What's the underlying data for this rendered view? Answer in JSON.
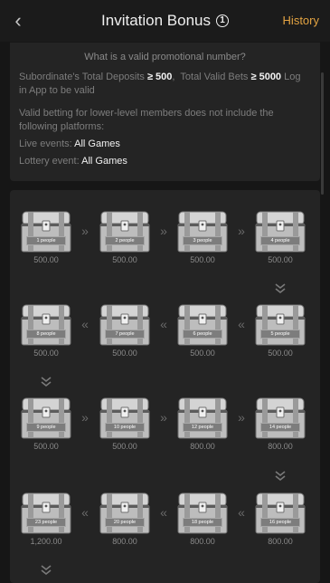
{
  "header": {
    "back_icon": "back-chevron-icon",
    "title": "Invitation Bonus",
    "info_icon": "info-circle-icon",
    "history_label": "History"
  },
  "info": {
    "question": "What is a valid promotional number?",
    "req_prefix": "Subordinate's Total Deposits",
    "req_ge1": "≥",
    "req_deposit": "500",
    "req_sep": ",",
    "req_bets_label": "Total Valid Bets",
    "req_ge2": "≥",
    "req_bets": "5000",
    "req_suffix": "Log in App to be valid",
    "note": "Valid betting for lower-level members does not include the following platforms:",
    "live_label": "Live events:",
    "live_value": "All Games",
    "lottery_label": "Lottery event:",
    "lottery_value": "All Games"
  },
  "rewards": [
    {
      "people": "1 people",
      "amount": "500.00"
    },
    {
      "people": "2 people",
      "amount": "500.00"
    },
    {
      "people": "3 people",
      "amount": "500.00"
    },
    {
      "people": "4 people",
      "amount": "500.00"
    },
    {
      "people": "5 people",
      "amount": "500.00"
    },
    {
      "people": "6 people",
      "amount": "500.00"
    },
    {
      "people": "7 people",
      "amount": "500.00"
    },
    {
      "people": "8 people",
      "amount": "500.00"
    },
    {
      "people": "9 people",
      "amount": "500.00"
    },
    {
      "people": "10 people",
      "amount": "500.00"
    },
    {
      "people": "12 people",
      "amount": "800.00"
    },
    {
      "people": "14 people",
      "amount": "800.00"
    },
    {
      "people": "16 people",
      "amount": "800.00"
    },
    {
      "people": "18 people",
      "amount": "800.00"
    },
    {
      "people": "20 people",
      "amount": "800.00"
    },
    {
      "people": "23 people",
      "amount": "1,200.00"
    }
  ],
  "colors": {
    "accent": "#e3a342",
    "chest_light": "#d4d4d4",
    "chest_dark": "#5c5c5c"
  }
}
